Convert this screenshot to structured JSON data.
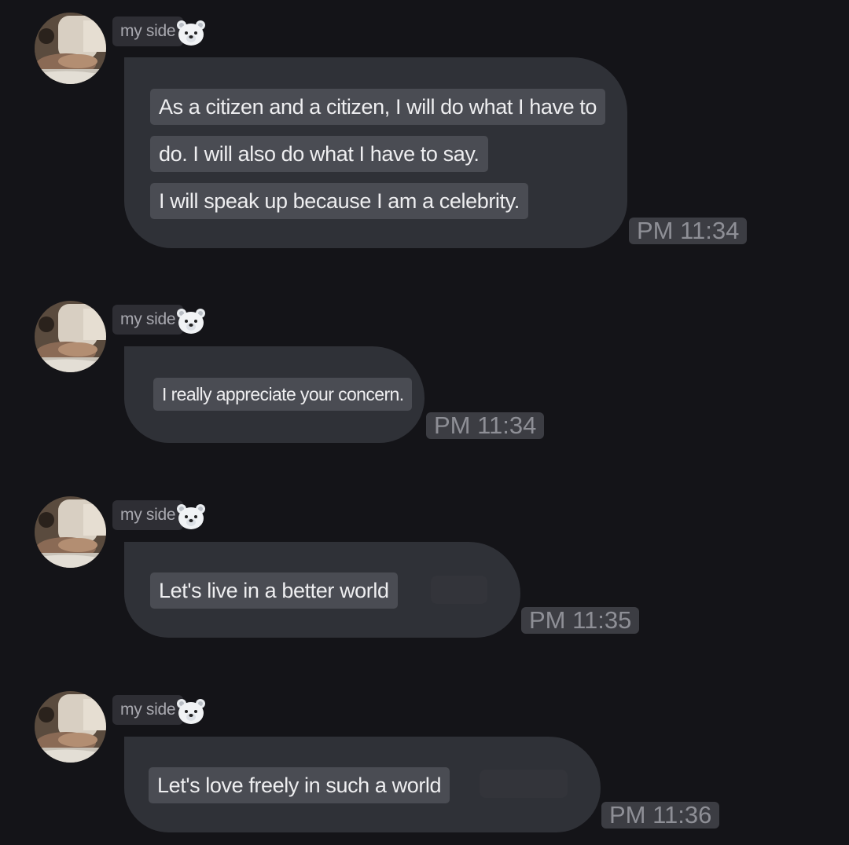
{
  "messages": [
    {
      "sender": "my side",
      "lines": [
        "As a citizen and a citizen, I will do what I have to",
        "do. I will also do what I have to say.",
        "I will speak up because I am a celebrity."
      ],
      "time": "PM 11:34"
    },
    {
      "sender": "my side",
      "lines": [
        "I really appreciate your concern."
      ],
      "time": "PM 11:34"
    },
    {
      "sender": "my side",
      "lines": [
        "Let's live in a better world"
      ],
      "time": "PM 11:35"
    },
    {
      "sender": "my side",
      "lines": [
        "Let's love freely in such a world"
      ],
      "time": "PM 11:36"
    }
  ],
  "icons": {
    "sender_badge": "polar-bear-face-icon",
    "avatar": "profile-photo"
  },
  "colors": {
    "background": "#141418",
    "bubble": "#2f3137",
    "text_chip": "#4a4c53",
    "time_chip": "#3c3d43"
  }
}
